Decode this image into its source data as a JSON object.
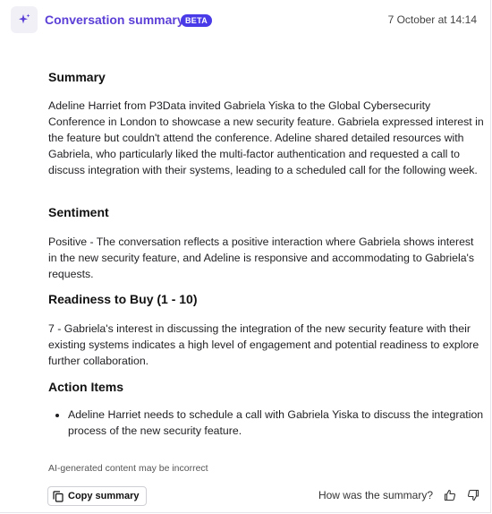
{
  "header": {
    "icon": "sparkle-icon",
    "title": "Conversation summary",
    "badge": "BETA",
    "timestamp": "7 October at 14:14",
    "accent_color": "#5b3fd6",
    "badge_color": "#4a3be8"
  },
  "sections": {
    "summary": {
      "heading": "Summary",
      "body": "Adeline Harriet from P3Data invited Gabriela Yiska to the Global Cybersecurity Conference in London to showcase a new security feature. Gabriela expressed interest in the feature but couldn't attend the conference. Adeline shared detailed resources with Gabriela, who particularly liked the multi-factor authentication and requested a call to discuss integration with their systems, leading to a scheduled call for the following week."
    },
    "sentiment": {
      "heading": "Sentiment",
      "body": "Positive - The conversation reflects a positive interaction where Gabriela shows interest in the new security feature, and Adeline is responsive and accommodating to Gabriela's requests."
    },
    "readiness": {
      "heading": "Readiness to Buy (1 - 10)",
      "body": "7 - Gabriela's interest in discussing the integration of the new security feature with their existing systems indicates a high level of engagement and potential readiness to explore further collaboration."
    },
    "actions": {
      "heading": "Action Items",
      "items": [
        "Adeline Harriet needs to schedule a call with Gabriela Yiska to discuss the integration process of the new security feature."
      ]
    }
  },
  "footer": {
    "disclaimer": "AI-generated content may be incorrect",
    "copy_label": "Copy summary",
    "copy_icon": "copy-icon",
    "feedback_question": "How was the summary?",
    "thumbs_up_icon": "thumbs-up-icon",
    "thumbs_down_icon": "thumbs-down-icon"
  }
}
